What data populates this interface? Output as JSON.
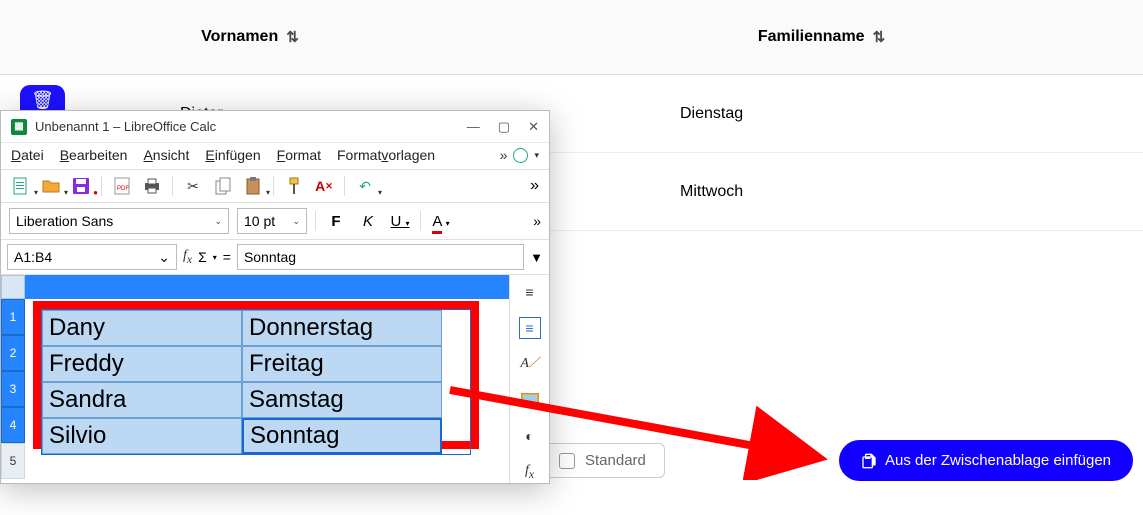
{
  "back": {
    "headers": {
      "vornamen": "Vornamen",
      "familienname": "Familienname"
    },
    "rows": [
      {
        "vor": "Dieter",
        "fam": "Dienstag"
      },
      {
        "vor": "",
        "fam": "Mittwoch"
      }
    ]
  },
  "bottom": {
    "standard": "Standard",
    "paste": "Aus der Zwischenablage einfügen"
  },
  "calc": {
    "title": "Unbenannt 1 – LibreOffice Calc",
    "menus": {
      "datei": "Datei",
      "bearbeiten": "Bearbeiten",
      "ansicht": "Ansicht",
      "einfuegen": "Einfügen",
      "format": "Format",
      "formatvorlagen": "Formatvorlagen"
    },
    "font": "Liberation Sans",
    "size": "10 pt",
    "bold": "F",
    "italic": "K",
    "underline": "U",
    "color_label": "A",
    "ref": "A1:B4",
    "sigma": "Σ",
    "eq": "=",
    "formula": "Sonntag",
    "rownums": [
      "1",
      "2",
      "3",
      "4",
      "5"
    ],
    "cells": [
      [
        "Dany",
        "Donnerstag"
      ],
      [
        "Freddy",
        "Freitag"
      ],
      [
        "Sandra",
        "Samstag"
      ],
      [
        "Silvio",
        "Sonntag"
      ]
    ]
  }
}
